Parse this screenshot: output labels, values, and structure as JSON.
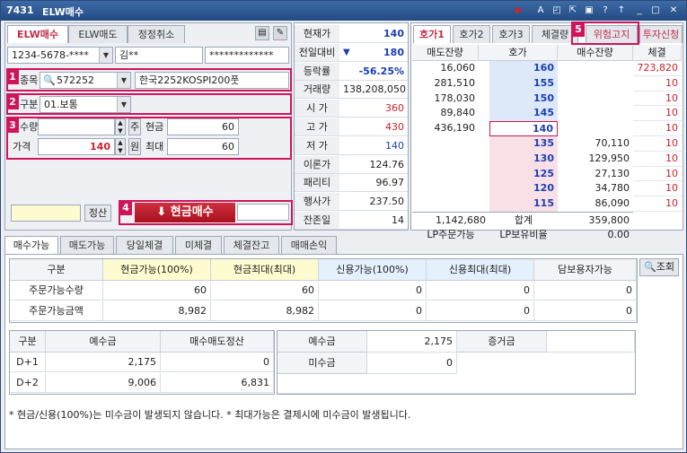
{
  "title": {
    "code": "7431",
    "name": "ELW매수"
  },
  "order_tabs": [
    "ELW매수",
    "ELW매도",
    "정정취소"
  ],
  "account": {
    "number": "1234-5678-****",
    "name": "김**",
    "password": "*************"
  },
  "form": {
    "item_label": "종목",
    "item_code": "572252",
    "item_name": "한국2252KOSPI200풋",
    "type_label": "구분",
    "type_value": "01.보통",
    "qty_label": "수량",
    "qty_unit": "주",
    "price_label": "가격",
    "price_value": "140",
    "price_unit": "원",
    "cash_label": "현금",
    "cash_value": "60",
    "max_label": "최대",
    "max_value": "60",
    "settle_btn": "정산",
    "buy_btn": "현금매수"
  },
  "badges": [
    "1",
    "2",
    "3",
    "4",
    "5"
  ],
  "quote": [
    {
      "label": "현재가",
      "value": "140"
    },
    {
      "label": "전일대비",
      "value": "180",
      "arrow": "▼"
    },
    {
      "label": "등락률",
      "value": "-56.25%"
    },
    {
      "label": "거래량",
      "value": "138,208,050"
    },
    {
      "label": "시 가",
      "value": "360"
    },
    {
      "label": "고 가",
      "value": "430"
    },
    {
      "label": "저 가",
      "value": "140"
    },
    {
      "label": "이론가",
      "value": "124.76"
    },
    {
      "label": "패리티",
      "value": "96.97"
    },
    {
      "label": "행사가",
      "value": "237.50"
    },
    {
      "label": "잔존일",
      "value": "14"
    }
  ],
  "book_tabs": [
    "호가1",
    "호가2",
    "호가3",
    "체결량",
    "위험고지",
    "투자신청"
  ],
  "book_headers": [
    "매도잔량",
    "호가",
    "매수잔량",
    "체결"
  ],
  "asks": [
    {
      "qty": "16,060",
      "price": "160"
    },
    {
      "qty": "281,510",
      "price": "155"
    },
    {
      "qty": "178,030",
      "price": "150"
    },
    {
      "qty": "89,840",
      "price": "145"
    },
    {
      "qty": "436,190",
      "price": "140"
    }
  ],
  "bids": [
    {
      "price": "135",
      "qty": "70,110"
    },
    {
      "price": "130",
      "qty": "129,950"
    },
    {
      "price": "125",
      "qty": "27,130"
    },
    {
      "price": "120",
      "qty": "34,780"
    },
    {
      "price": "115",
      "qty": "86,090"
    }
  ],
  "fills": [
    "723,820",
    "10",
    "10",
    "10",
    "10",
    "10",
    "10",
    "10",
    "10",
    "10"
  ],
  "book_total": {
    "ask": "1,142,680",
    "label": "합계",
    "bid": "359,800"
  },
  "book_lp": {
    "label1": "LP주문가능",
    "label2": "LP보유비율",
    "value": "0.00"
  },
  "bottom_tabs": [
    "매수가능",
    "매도가능",
    "당일체결",
    "미체결",
    "체결잔고",
    "매매손익"
  ],
  "lookup_btn": "조회",
  "avail_headers": [
    "구분",
    "현금가능(100%)",
    "현금최대(최대)",
    "신용가능(100%)",
    "신용최대(최대)",
    "담보용자가능"
  ],
  "avail_rows": [
    {
      "label": "주문가능수량",
      "values": [
        "60",
        "60",
        "0",
        "0",
        "0"
      ]
    },
    {
      "label": "주문가능금액",
      "values": [
        "8,982",
        "8,982",
        "0",
        "0",
        "0"
      ]
    }
  ],
  "deposit_headers": [
    "구분",
    "예수금",
    "매수매도정산"
  ],
  "deposit_rows": [
    {
      "label": "D+1",
      "values": [
        "2,175",
        "0"
      ]
    },
    {
      "label": "D+2",
      "values": [
        "9,006",
        "6,831"
      ]
    }
  ],
  "deposit2": {
    "h1": "예수금",
    "v1": "2,175",
    "h2": "증거금",
    "h3": "미수금",
    "v3": "0"
  },
  "note": "* 현금/신용(100%)는 미수금이 발생되지 않습니다. * 최대가능은 결제시에 미수금이 발생됩니다."
}
